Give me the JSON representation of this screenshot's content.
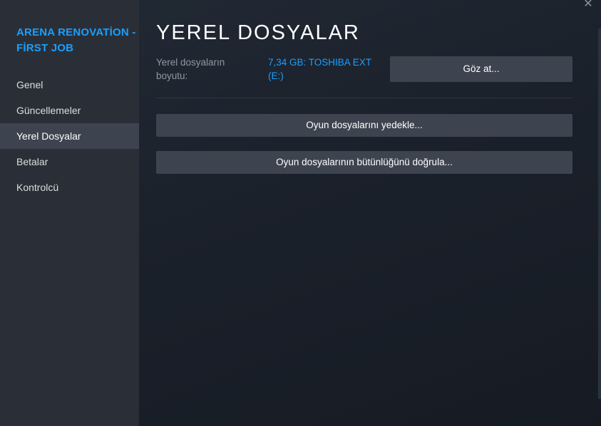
{
  "app": {
    "title": "ARENA RENOVATİON - FİRST JOB"
  },
  "sidebar": {
    "items": [
      {
        "label": "Genel",
        "active": false
      },
      {
        "label": "Güncellemeler",
        "active": false
      },
      {
        "label": "Yerel Dosyalar",
        "active": true
      },
      {
        "label": "Betalar",
        "active": false
      },
      {
        "label": "Kontrolcü",
        "active": false
      }
    ]
  },
  "window": {
    "close_glyph": "✕"
  },
  "main": {
    "title": "YEREL DOSYALAR",
    "size_label": "Yerel dosyaların boyutu:",
    "size_value": "7,34 GB: TOSHIBA EXT (E:)",
    "browse_label": "Göz at...",
    "backup_label": "Oyun dosyalarını yedekle...",
    "verify_label": "Oyun dosyalarının bütünlüğünü doğrula..."
  },
  "colors": {
    "accent": "#1a9fff",
    "sidebar_bg": "#2a2f37",
    "active_item_bg": "#3d4450",
    "button_bg": "#3d4450",
    "content_bg": "#1b212b"
  }
}
